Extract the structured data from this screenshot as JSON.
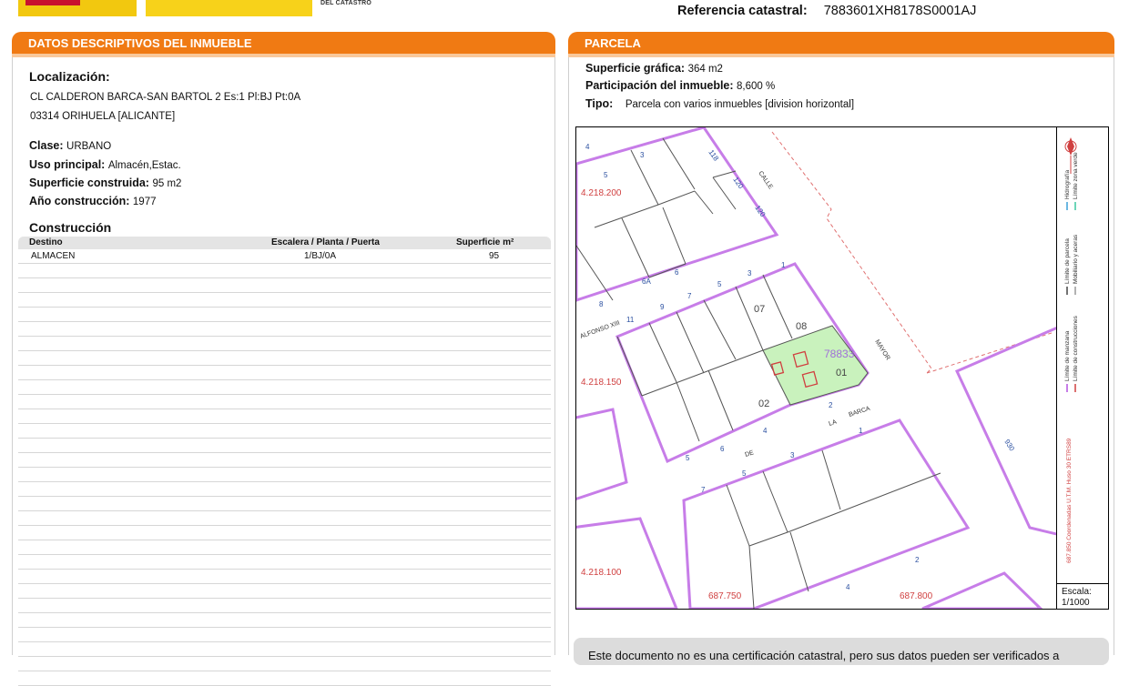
{
  "header": {
    "logo_subtitle": "DEL CATASTRO",
    "ref_label": "Referencia catastral:",
    "ref_value": "7883601XH8178S0001AJ"
  },
  "left_panel": {
    "title_prefix": "DATOS DESCRIPTIVOS DEL ",
    "title_bold": "INMUEBLE",
    "localizacion_label": "Localización:",
    "address_line1": "CL CALDERON BARCA-SAN BARTOL 2 Es:1 Pl:BJ Pt:0A",
    "address_line2": "03314 ORIHUELA [ALICANTE]",
    "clase_label": "Clase:",
    "clase_value": "URBANO",
    "uso_label": "Uso principal:",
    "uso_value": "Almacén,Estac.",
    "sup_label": "Superficie construida:",
    "sup_value": "95 m2",
    "anio_label": "Año construcción:",
    "anio_value": "1977",
    "construccion_label": "Construcción",
    "table": {
      "headers": [
        "Destino",
        "Escalera / Planta / Puerta",
        "Superficie m²"
      ],
      "rows": [
        [
          "ALMACEN",
          "1/BJ/0A",
          "95"
        ]
      ]
    }
  },
  "right_panel": {
    "title": "PARCELA",
    "sup_grafica_label": "Superficie gráfica:",
    "sup_grafica_value": "364 m2",
    "participacion_label": "Participación del inmueble:",
    "participacion_value": "8,600 %",
    "tipo_label": "Tipo:",
    "tipo_value": "Parcela con varios inmuebles [division horizontal]"
  },
  "map": {
    "coords_y": [
      "4.218.200",
      "4.218.150",
      "4.218.100"
    ],
    "coords_x": [
      "687.750",
      "687.800"
    ],
    "parcel_label": "78833",
    "street_labels": [
      "CALLE",
      "MAYOR",
      "ALFONSO XIII",
      "LA",
      "BARCA",
      "DE"
    ],
    "house_numbers": [
      "4",
      "3",
      "5",
      "6",
      "8",
      "6A",
      "11",
      "9",
      "7",
      "5",
      "3",
      "1",
      "2",
      "4",
      "6",
      "5",
      "3",
      "5",
      "7",
      "1",
      "2",
      "4",
      "118",
      "120",
      "120",
      "930"
    ],
    "block_labels": [
      "07",
      "08",
      "01",
      "02"
    ],
    "legend": {
      "item1": "Límite de manzana",
      "item2": "Límite de construcciones",
      "item3": "Límite de parcela",
      "item4": "Mobiliario y aceras",
      "item5": "Hidrografía",
      "item6": "Límite zona verde",
      "coords_note": "687.850 Coordenadas U.T.M. Huso 30 ETRS89"
    },
    "scale_label": "Escala:",
    "scale_value": "1/1000"
  },
  "footer_note": "Este documento no es una certificación catastral, pero sus datos pueden ser verificados a",
  "colors": {
    "accent": "#f07a13",
    "parcel_fill": "#c9f2bd",
    "lot_line": "#c77de8"
  }
}
